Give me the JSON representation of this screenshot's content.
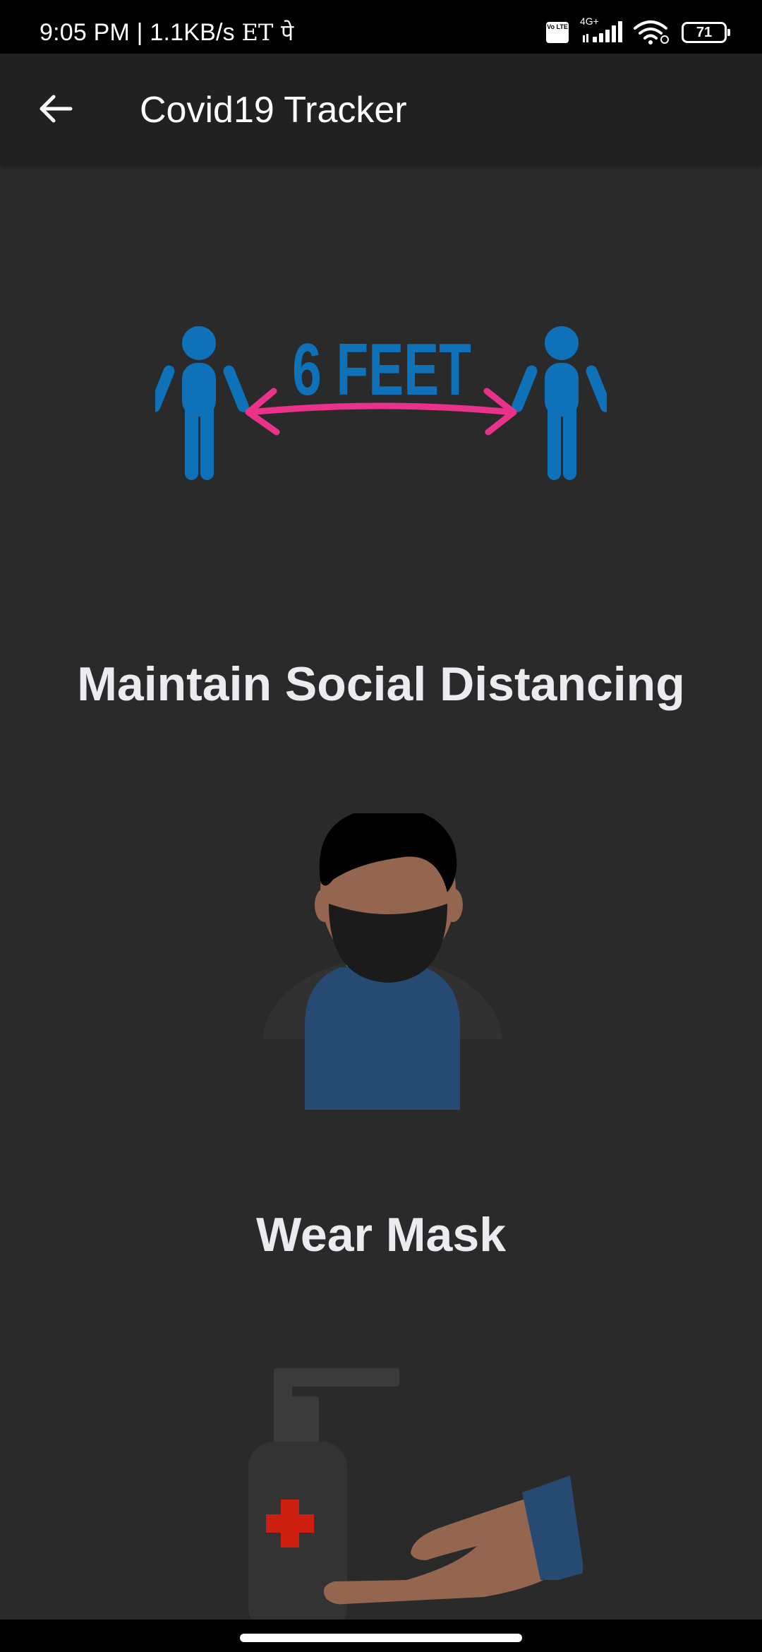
{
  "status_bar": {
    "time_speed": "9:05 PM | 1.1KB/s",
    "extra_glyphs": "ET पे",
    "volte_label": "Vo LTE",
    "network_label": "4G+",
    "battery_level": "71"
  },
  "app_bar": {
    "title": "Covid19 Tracker"
  },
  "tips": [
    {
      "caption": "Maintain Social Distancing",
      "illustration_text": "6 FEET"
    },
    {
      "caption": "Wear Mask"
    },
    {
      "caption": ""
    }
  ],
  "colors": {
    "status_bar": "#000000",
    "app_bar": "#212121",
    "background": "#2a2a2b",
    "caption_text": "#ecebf0",
    "figure_blue": "#0f71b8",
    "arrow_pink": "#e9338a",
    "shirt_blue": "#274a72",
    "skin": "#946650",
    "cross_red": "#cc1f10"
  }
}
